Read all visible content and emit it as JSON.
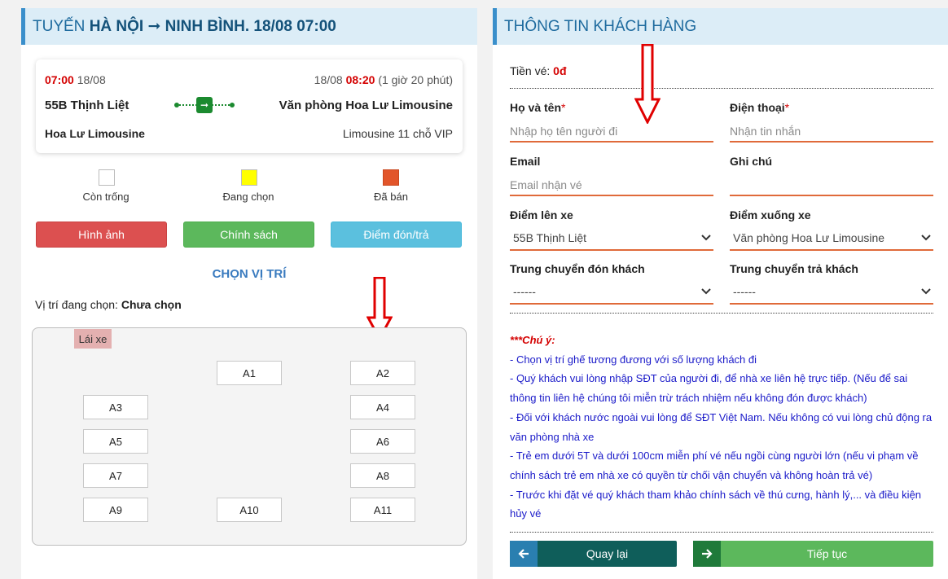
{
  "left": {
    "header": {
      "prefix": "TUYẾN",
      "from": "HÀ NỘI",
      "arrow": "➞",
      "to": "NINH BÌNH",
      "datetime": ". 18/08 07:00"
    },
    "trip": {
      "depart_time": "07:00",
      "depart_date": "18/08",
      "arrive_date": "18/08",
      "arrive_time": "08:20",
      "duration": "(1 giờ 20 phút)",
      "origin": "55B Thịnh Liệt",
      "destination": "Văn phòng Hoa Lư Limousine",
      "operator": "Hoa Lư Limousine",
      "vehicle": "Limousine 11 chỗ VIP"
    },
    "legend": [
      {
        "label": "Còn trống",
        "color": "#ffffff"
      },
      {
        "label": "Đang chọn",
        "color": "#ffff00"
      },
      {
        "label": "Đã bán",
        "color": "#e2552a"
      }
    ],
    "buttons": {
      "images": "Hình ảnh",
      "policy": "Chính sách",
      "pickup": "Điểm đón/trả"
    },
    "choose_position": "CHỌN VỊ TRÍ",
    "selected_label": "Vị trí đang chọn:",
    "selected_value": "Chưa chọn",
    "driver_label": "Lái xe",
    "seats": [
      "A1",
      "A2",
      "A3",
      "A4",
      "A5",
      "A6",
      "A7",
      "A8",
      "A9",
      "A10",
      "A11"
    ]
  },
  "right": {
    "header": "THÔNG TIN KHÁCH HÀNG",
    "price_label": "Tiền vé:",
    "price_value": "0đ",
    "fields": {
      "name_label": "Họ và tên",
      "name_placeholder": "Nhập họ tên người đi",
      "phone_label": "Điện thoại",
      "phone_placeholder": "Nhận tin nhắn",
      "email_label": "Email",
      "email_placeholder": "Email nhận vé",
      "note_label": "Ghi chú",
      "note_placeholder": "",
      "pickup_label": "Điểm lên xe",
      "pickup_value": "55B Thịnh Liệt",
      "dropoff_label": "Điểm xuống xe",
      "dropoff_value": "Văn phòng Hoa Lư Limousine",
      "transfer_pickup_label": "Trung chuyển đón khách",
      "transfer_pickup_value": "------",
      "transfer_drop_label": "Trung chuyển trả khách",
      "transfer_drop_value": "------",
      "required_mark": "*"
    },
    "notes": {
      "title": "***Chú ý:",
      "lines": [
        "- Chọn vị trí ghế tương đương với số lượng khách đi",
        "- Quý khách vui lòng nhập SĐT của người đi, để nhà xe liên hệ trực tiếp. (Nếu để sai thông tin liên hệ chúng tôi miễn trừ trách nhiệm nếu không đón được khách)",
        "- Đối với khách nước ngoài vui lòng để SĐT Việt Nam. Nếu không có vui lòng chủ động ra văn phòng nhà xe",
        "- Trẻ em dưới 5T và dưới 100cm miễn phí vé nếu ngồi cùng người lớn (nếu vi phạm về chính sách trẻ em nhà xe có quyền từ chối vận chuyển và không hoàn trả vé)",
        "- Trước khi đặt vé quý khách tham khảo chính sách về thú cưng, hành lý,... và điều kiện hủy vé"
      ]
    },
    "back_button": "Quay lại",
    "next_button": "Tiếp tục"
  },
  "colors": {
    "header_bg": "#dcedf7",
    "accent_blue": "#3a8fcb",
    "field_underline": "#e06a3a",
    "btn_red": "#dc5050",
    "btn_green": "#5cb85c",
    "btn_cyan": "#5bc0de",
    "btn_back": "#0f5e5a",
    "btn_next": "#5cb85c",
    "arrow_red": "#e00000"
  }
}
